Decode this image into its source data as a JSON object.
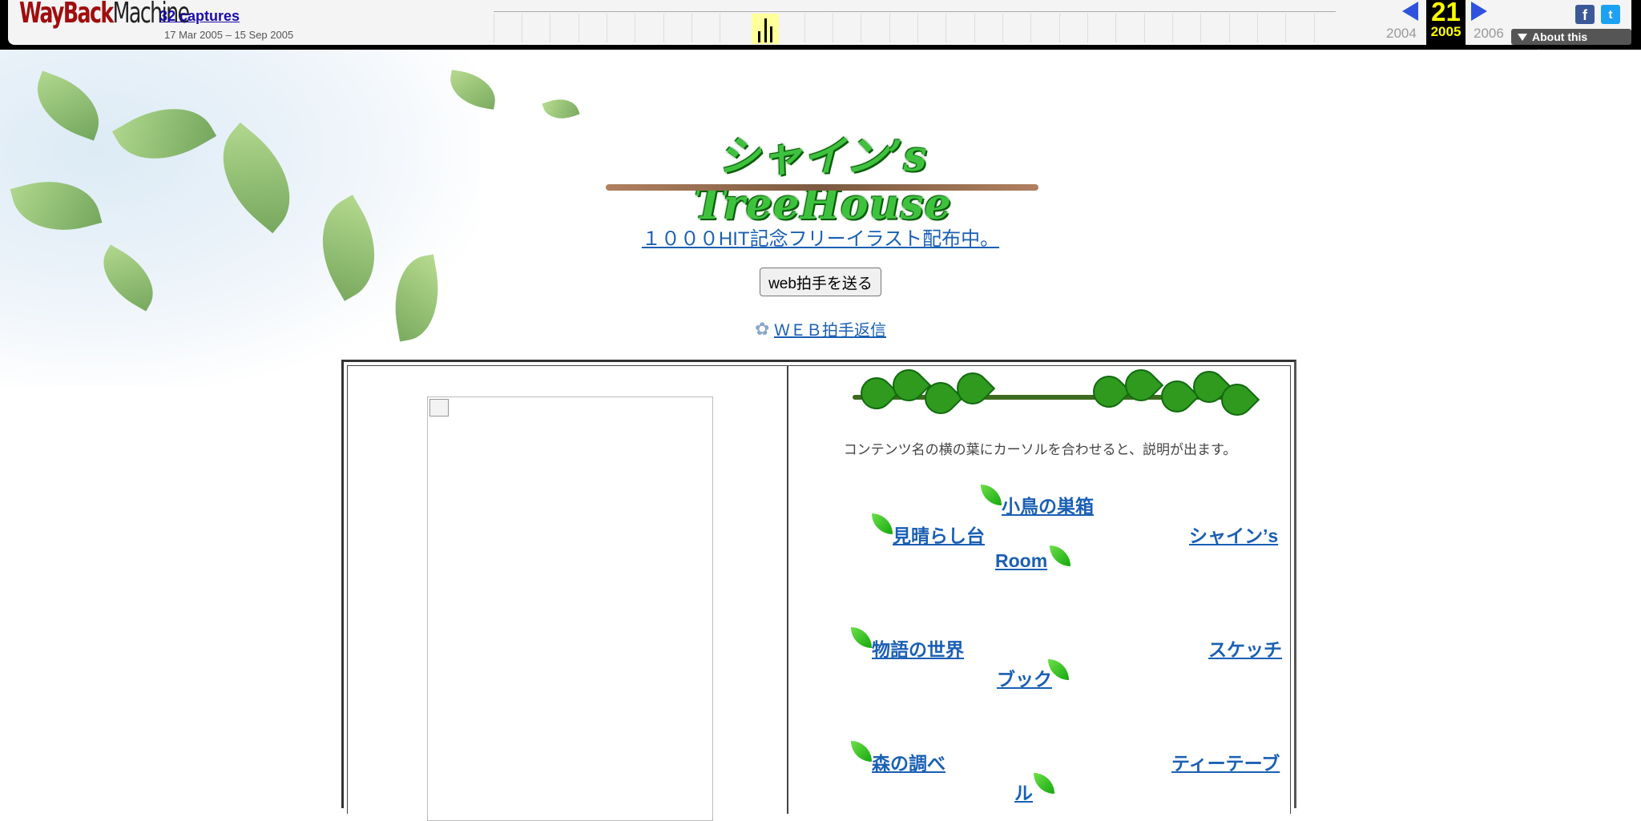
{
  "wayback": {
    "logo_part1": "WayBack",
    "logo_part2": "Machine",
    "captures_label": "32 captures",
    "date_range": "17 Mar 2005 – 15 Sep 2005",
    "prev_year": "2004",
    "current_day": "21",
    "current_year": "2005",
    "next_year": "2006",
    "about_label": "About this capture",
    "facebook_icon": "f",
    "twitter_icon": "t"
  },
  "header": {
    "title": "シャイン’s TreeHouse",
    "hit_link": "１０００HIT記念フリーイラスト配布中。",
    "clap_button": "web拍手を送る",
    "reply_icon": "✿",
    "reply_link": "ＷＥＢ拍手返信"
  },
  "content": {
    "hint": "コンテンツ名の横の葉にカーソルを合わせると、説明が出ます。",
    "nav": {
      "bird_nest": "小鳥の巣箱",
      "lookout": "見晴らし台",
      "shine_room_1": "シャイン’s",
      "shine_room_2": "Room",
      "stories": "物語の世界",
      "sketch_1": "スケッチ",
      "sketch_2": "ブック",
      "forest": "森の調べ",
      "tea_table_1": "ティーテーブ",
      "tea_table_2": "ル"
    }
  }
}
